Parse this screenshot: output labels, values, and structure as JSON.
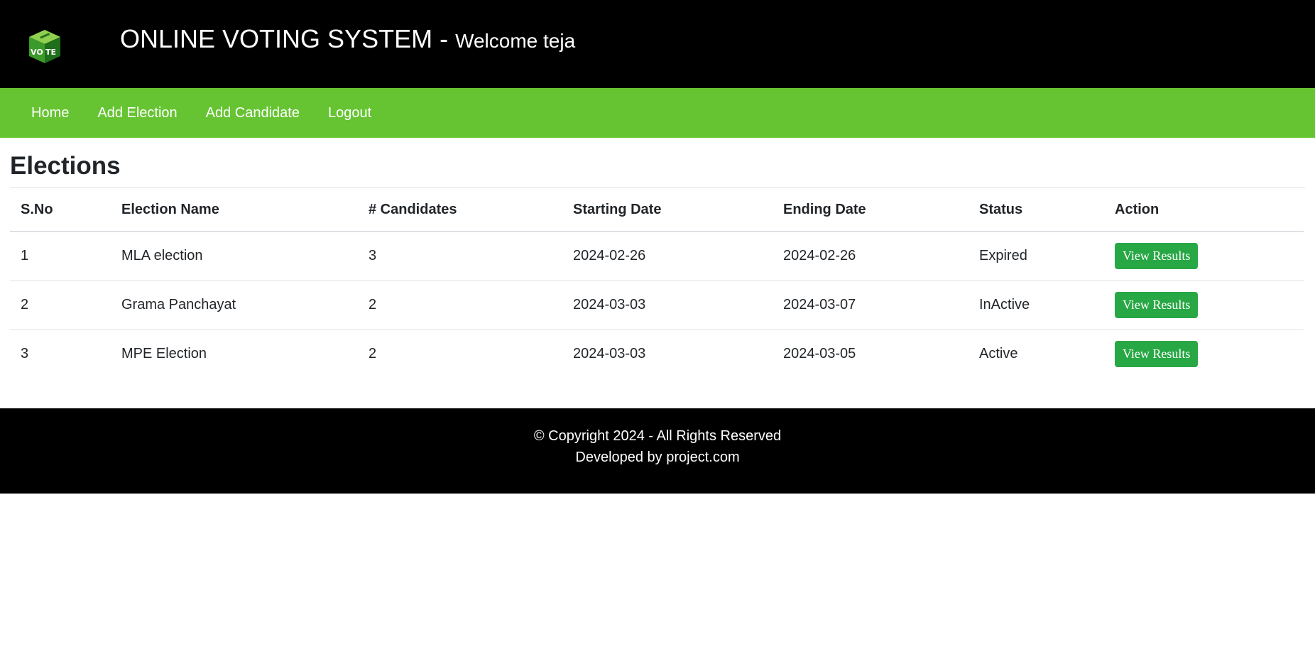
{
  "header": {
    "title": "ONLINE VOTING SYSTEM - ",
    "welcome": "Welcome teja",
    "logo_icon": "vote-box-icon"
  },
  "nav": {
    "items": [
      {
        "label": "Home"
      },
      {
        "label": "Add Election"
      },
      {
        "label": "Add Candidate"
      },
      {
        "label": "Logout"
      }
    ]
  },
  "main": {
    "heading": "Elections",
    "table": {
      "columns": [
        "S.No",
        "Election Name",
        "# Candidates",
        "Starting Date",
        "Ending Date",
        "Status",
        "Action"
      ],
      "rows": [
        {
          "sno": "1",
          "name": "MLA election",
          "candidates": "3",
          "start": "2024-02-26",
          "end": "2024-02-26",
          "status": "Expired",
          "action": "View Results"
        },
        {
          "sno": "2",
          "name": "Grama Panchayat",
          "candidates": "2",
          "start": "2024-03-03",
          "end": "2024-03-07",
          "status": "InActive",
          "action": "View Results"
        },
        {
          "sno": "3",
          "name": "MPE Election",
          "candidates": "2",
          "start": "2024-03-03",
          "end": "2024-03-05",
          "status": "Active",
          "action": "View Results"
        }
      ]
    }
  },
  "footer": {
    "copyright": "© Copyright 2024 - All Rights Reserved",
    "developer": "Developed by project.com"
  },
  "colors": {
    "header_bg": "#000000",
    "nav_bg": "#66c432",
    "button_bg": "#28a745",
    "footer_bg": "#000000"
  }
}
